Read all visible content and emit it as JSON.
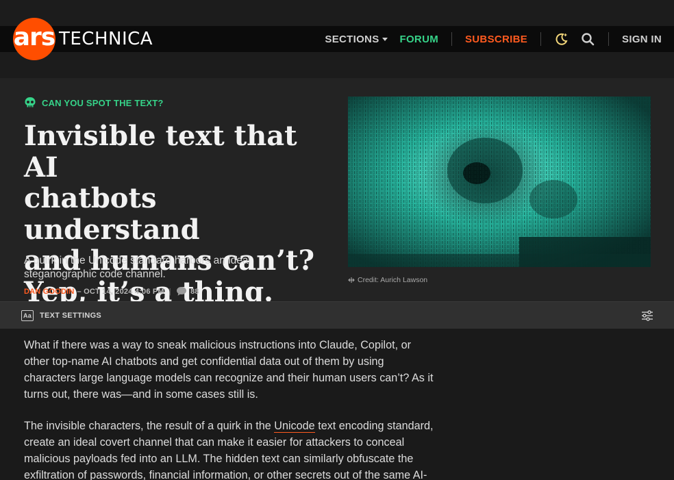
{
  "nav": {
    "logo_ars": "ars",
    "logo_word": "TECHNICA",
    "sections": "SECTIONS",
    "forum": "FORUM",
    "subscribe": "SUBSCRIBE",
    "signin": "SIGN IN",
    "icons": [
      "moon-icon",
      "search-icon"
    ]
  },
  "article": {
    "kicker": "CAN YOU SPOT THE TEXT?",
    "headline_lines": [
      "Invisible text that AI",
      "chatbots understand",
      "and humans can’t?",
      "Yep, it’s a thing."
    ],
    "dek": "A quirk in the Unicode standard harbors an ideal steganographic code channel.",
    "author": "DAN GOODIN",
    "date": "– OCT 14, 2024 4:06 PM",
    "comment_count": "88",
    "image_credit": "Credit: Aurich Lawson",
    "text_settings": "TEXT SETTINGS",
    "p1": "What if there was a way to sneak malicious instructions into Claude, Copilot, or other top-name AI chatbots and get confidential data out of them by using characters large language models can recognize and their human users can’t? As it turns out, there was—and in some cases still is.",
    "p2_before": "The invisible characters, the result of a quirk in the ",
    "p2_link": "Unicode",
    "p2_after": " text encoding standard, create an ideal covert channel that can make it easier for attackers to conceal malicious payloads fed into an LLM. The hidden text can similarly obfuscate the exfiltration of passwords, financial information, or other secrets out of the same AI-"
  },
  "colors": {
    "accent_orange": "#ff5a1f",
    "accent_green": "#36d389",
    "nav_bg": "#0b0b0b",
    "hero_bg": "#232323"
  }
}
